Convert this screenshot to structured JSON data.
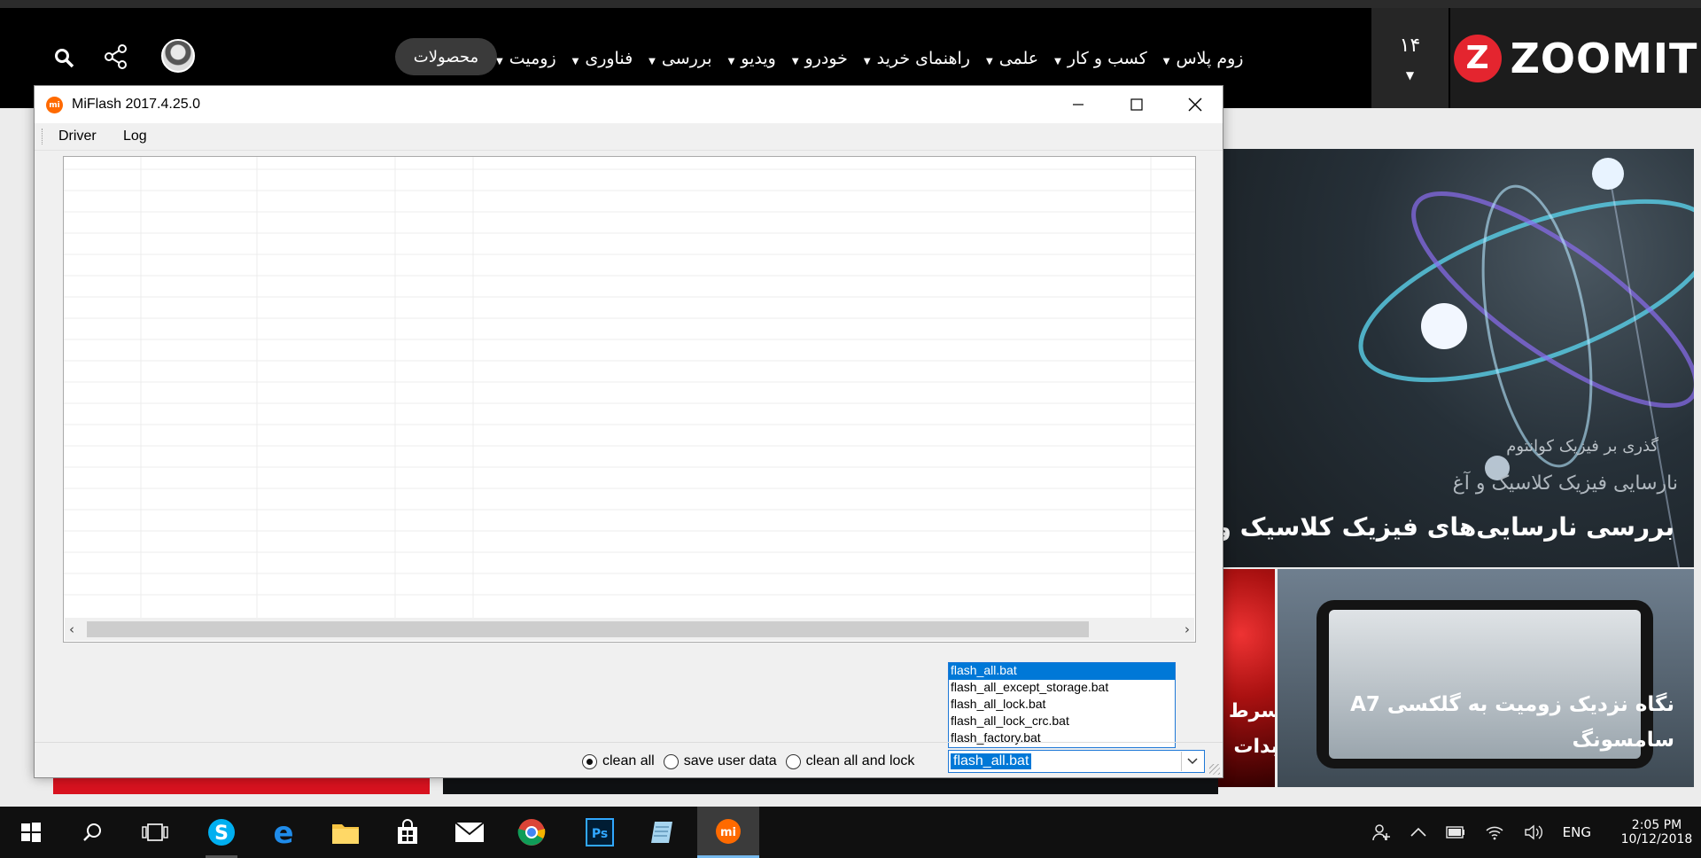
{
  "site": {
    "logo_word": "ZOOMIT",
    "issue_number": "۱۴",
    "nav": [
      "زومیت",
      "فناوری",
      "بررسی",
      "ویدیو",
      "خودرو",
      "راهنمای خرید",
      "علمی",
      "کسب و کار",
      "زوم پلاس"
    ],
    "products_label": "محصولات",
    "hero": {
      "kicker": "گذری بر فیزیک کوانتوم",
      "subtitle": "نارسایی فیزیک کلاسیک و آغ",
      "headline": "بررسی نارسایی‌های فیزیک کلاسیک و آغا"
    },
    "card_red": {
      "line1": "سرط",
      "line2": "بدات"
    },
    "card_phone": {
      "line1": "نگاه نزدیک زومیت به گلکسی A7",
      "line2": "سامسونگ"
    }
  },
  "window": {
    "title": "MiFlash 2017.4.25.0",
    "app_icon_text": "mi",
    "menu": [
      "Driver",
      "Log"
    ],
    "dropdown_options": [
      "flash_all.bat",
      "flash_all_except_storage.bat",
      "flash_all_lock.bat",
      "flash_all_lock_crc.bat",
      "flash_factory.bat"
    ],
    "selected_script": "flash_all.bat",
    "radios": [
      {
        "label": "clean all",
        "checked": true
      },
      {
        "label": "save user data",
        "checked": false
      },
      {
        "label": "clean all and lock",
        "checked": false
      }
    ]
  },
  "taskbar": {
    "apps": [
      "start-icon",
      "search-icon",
      "task-view-icon",
      "skype-icon",
      "edge-icon",
      "file-explorer-icon",
      "store-icon",
      "mail-icon",
      "chrome-icon",
      "photoshop-icon",
      "notepad-icon",
      "miflash-icon"
    ],
    "language": "ENG",
    "time": "2:05 PM",
    "date": "10/12/2018"
  },
  "colors": {
    "accent": "#0078d7",
    "brand": "#e4252f",
    "miflash": "#ff6a00"
  }
}
